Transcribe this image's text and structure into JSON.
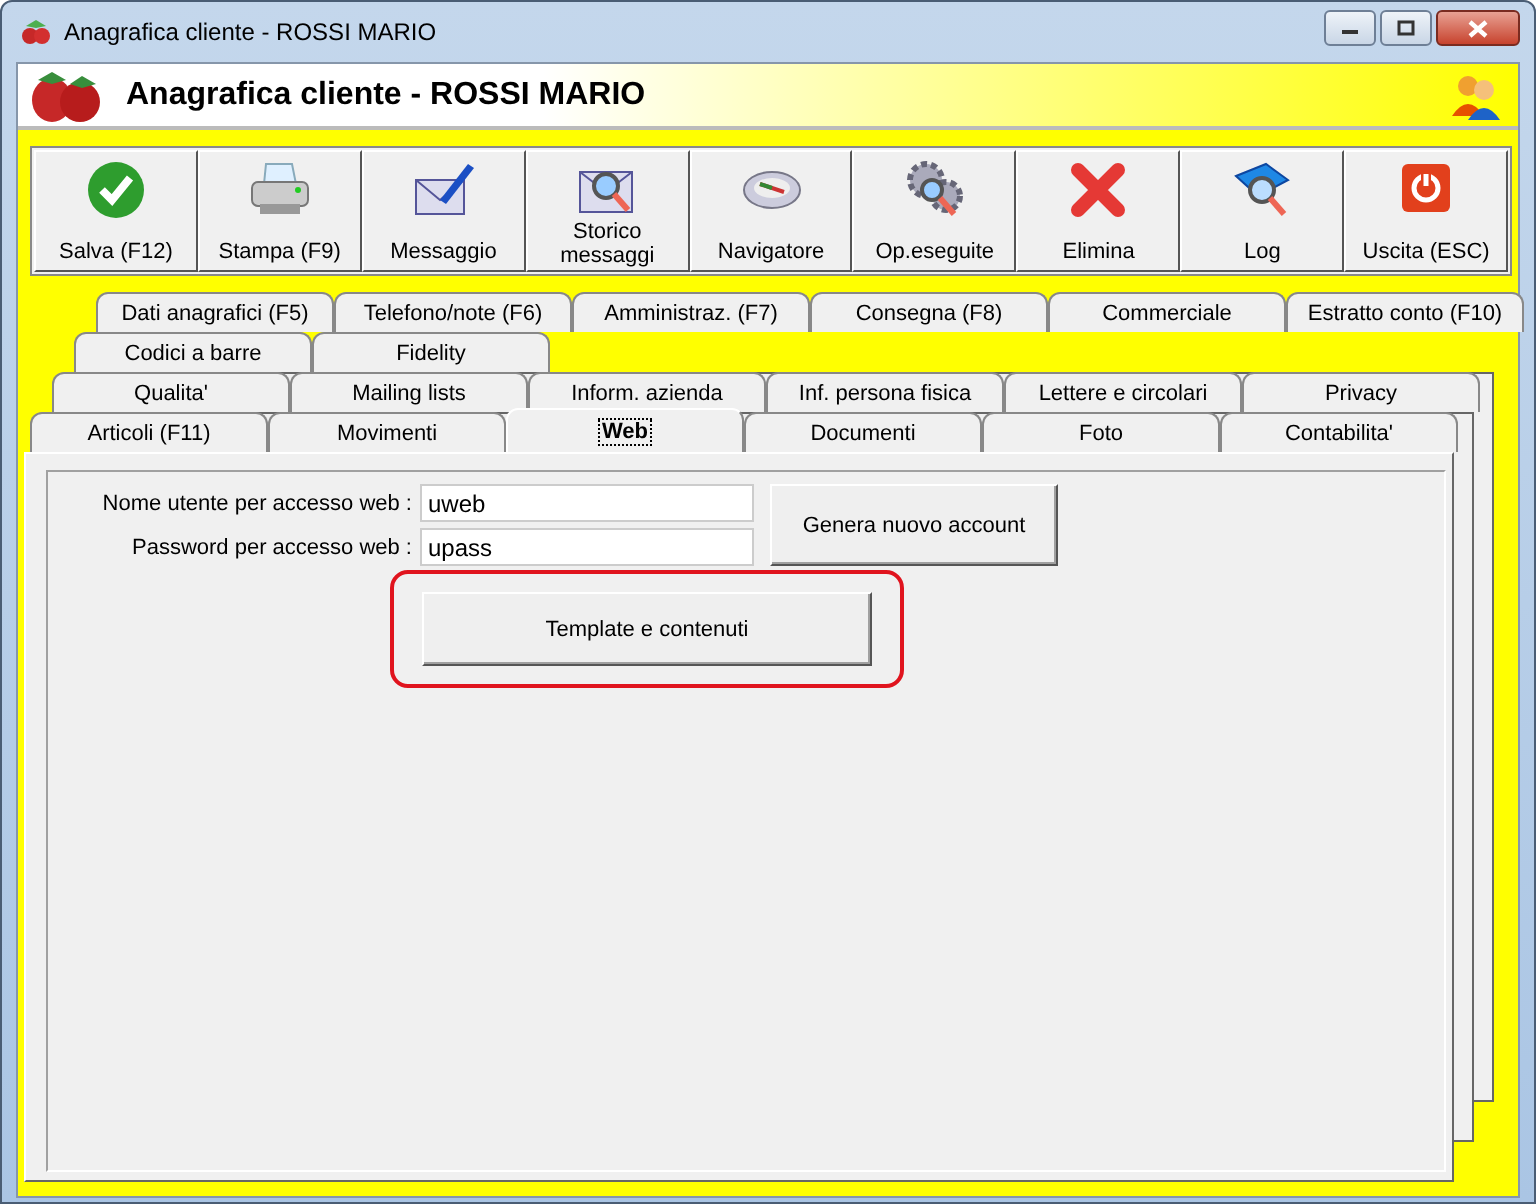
{
  "window": {
    "title": "Anagrafica cliente - ROSSI MARIO"
  },
  "header": {
    "title": "Anagrafica cliente - ROSSI MARIO"
  },
  "toolbar": [
    {
      "label": "Salva (F12)",
      "kind": "check"
    },
    {
      "label": "Stampa (F9)",
      "kind": "printer"
    },
    {
      "label": "Messaggio",
      "kind": "mail-pen"
    },
    {
      "label": "Storico messaggi",
      "kind": "mail-search"
    },
    {
      "label": "Navigatore",
      "kind": "compass"
    },
    {
      "label": "Op.eseguite",
      "kind": "gears"
    },
    {
      "label": "Elimina",
      "kind": "cross"
    },
    {
      "label": "Log",
      "kind": "book"
    },
    {
      "label": "Uscita (ESC)",
      "kind": "power"
    }
  ],
  "tab_rows": [
    {
      "tabs": [
        {
          "label": "Dati anagrafici (F5)",
          "selected": false
        },
        {
          "label": "Telefono/note (F6)",
          "selected": false
        },
        {
          "label": "Amministraz. (F7)",
          "selected": false
        },
        {
          "label": "Consegna (F8)",
          "selected": false
        },
        {
          "label": "Commerciale",
          "selected": false
        },
        {
          "label": "Estratto conto (F10)",
          "selected": false
        }
      ]
    },
    {
      "tabs": [
        {
          "label": "Codici a barre",
          "selected": false
        },
        {
          "label": "Fidelity",
          "selected": false
        }
      ]
    },
    {
      "tabs": [
        {
          "label": "Qualita'",
          "selected": false
        },
        {
          "label": "Mailing lists",
          "selected": false
        },
        {
          "label": "Inform. azienda",
          "selected": false
        },
        {
          "label": "Inf. persona fisica",
          "selected": false
        },
        {
          "label": "Lettere e circolari",
          "selected": false
        },
        {
          "label": "Privacy",
          "selected": false
        }
      ]
    },
    {
      "tabs": [
        {
          "label": "Articoli (F11)",
          "selected": false
        },
        {
          "label": "Movimenti",
          "selected": false
        },
        {
          "label": "Web",
          "selected": true
        },
        {
          "label": "Documenti",
          "selected": false
        },
        {
          "label": "Foto",
          "selected": false
        },
        {
          "label": "Contabilita'",
          "selected": false
        }
      ]
    }
  ],
  "fields": [
    {
      "label": "Nome utente per accesso web :",
      "value": "uweb"
    },
    {
      "label": "Password per accesso web :",
      "value": "upass"
    }
  ],
  "generate_button": {
    "label": "Genera nuovo account"
  },
  "template_button": {
    "label": "Template e contenuti",
    "highlighted": true
  }
}
